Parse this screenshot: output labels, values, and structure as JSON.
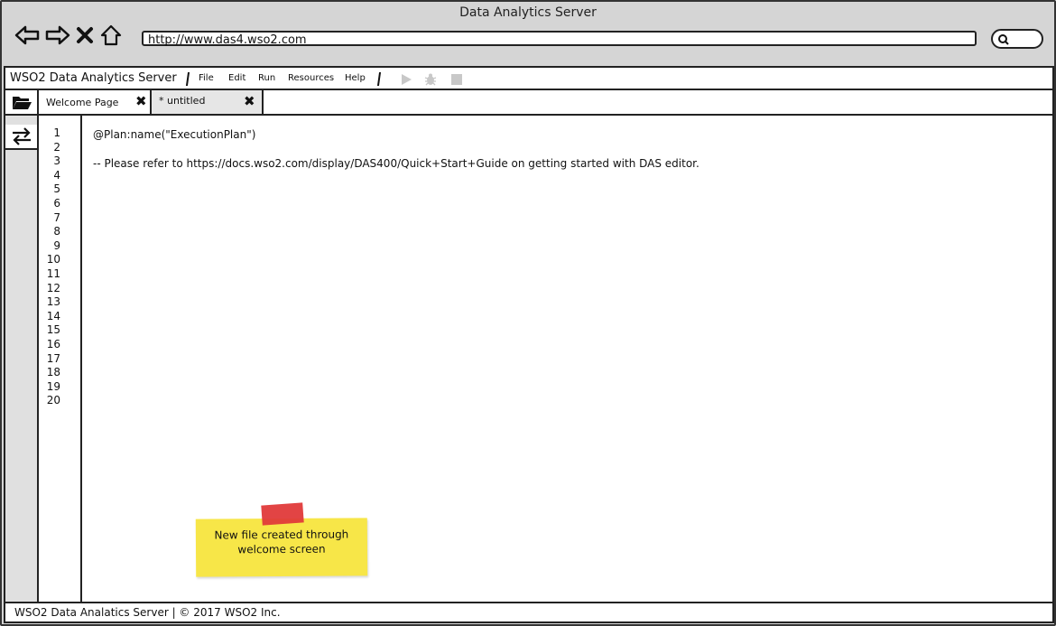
{
  "browser": {
    "title": "Data Analytics Server",
    "url": "http://www.das4.wso2.com",
    "nav_icons": [
      "back-arrow-icon",
      "forward-arrow-icon",
      "stop-x-icon",
      "home-icon"
    ],
    "search_icon": "search-icon"
  },
  "app": {
    "title": "WSO2 Data Analytics Server",
    "menu": [
      "File",
      "Edit",
      "Run",
      "Resources",
      "Help"
    ],
    "toolbar_icons": [
      "play-icon",
      "debug-bug-icon",
      "stop-icon"
    ]
  },
  "sidebar": {
    "items": [
      {
        "icon": "folder-open-icon"
      },
      {
        "icon": "swap-arrows-icon"
      }
    ]
  },
  "tabs": [
    {
      "label": "Welcome Page",
      "close": "✖"
    },
    {
      "label": "* untitled",
      "close": "✖"
    }
  ],
  "editor": {
    "line_numbers": [
      "1",
      "2",
      "3",
      "4",
      "5",
      "6",
      "7",
      "8",
      "9",
      "10",
      "11",
      "12",
      "13",
      "14",
      "15",
      "16",
      "17",
      "18",
      "19",
      "20"
    ],
    "lines": [
      "@Plan:name(\"ExecutionPlan\")",
      "",
      "-- Please refer to https://docs.wso2.com/display/DAS400/Quick+Start+Guide on getting started with DAS editor."
    ]
  },
  "sticky_note": {
    "line1": "New file created through",
    "line2": "welcome screen"
  },
  "footer": {
    "text": "WSO2 Data Analatics Server | © 2017 WSO2 Inc."
  },
  "colors": {
    "chrome": "#d5d5d5",
    "sticky": "#f7e648",
    "tape": "#e03a3a"
  }
}
